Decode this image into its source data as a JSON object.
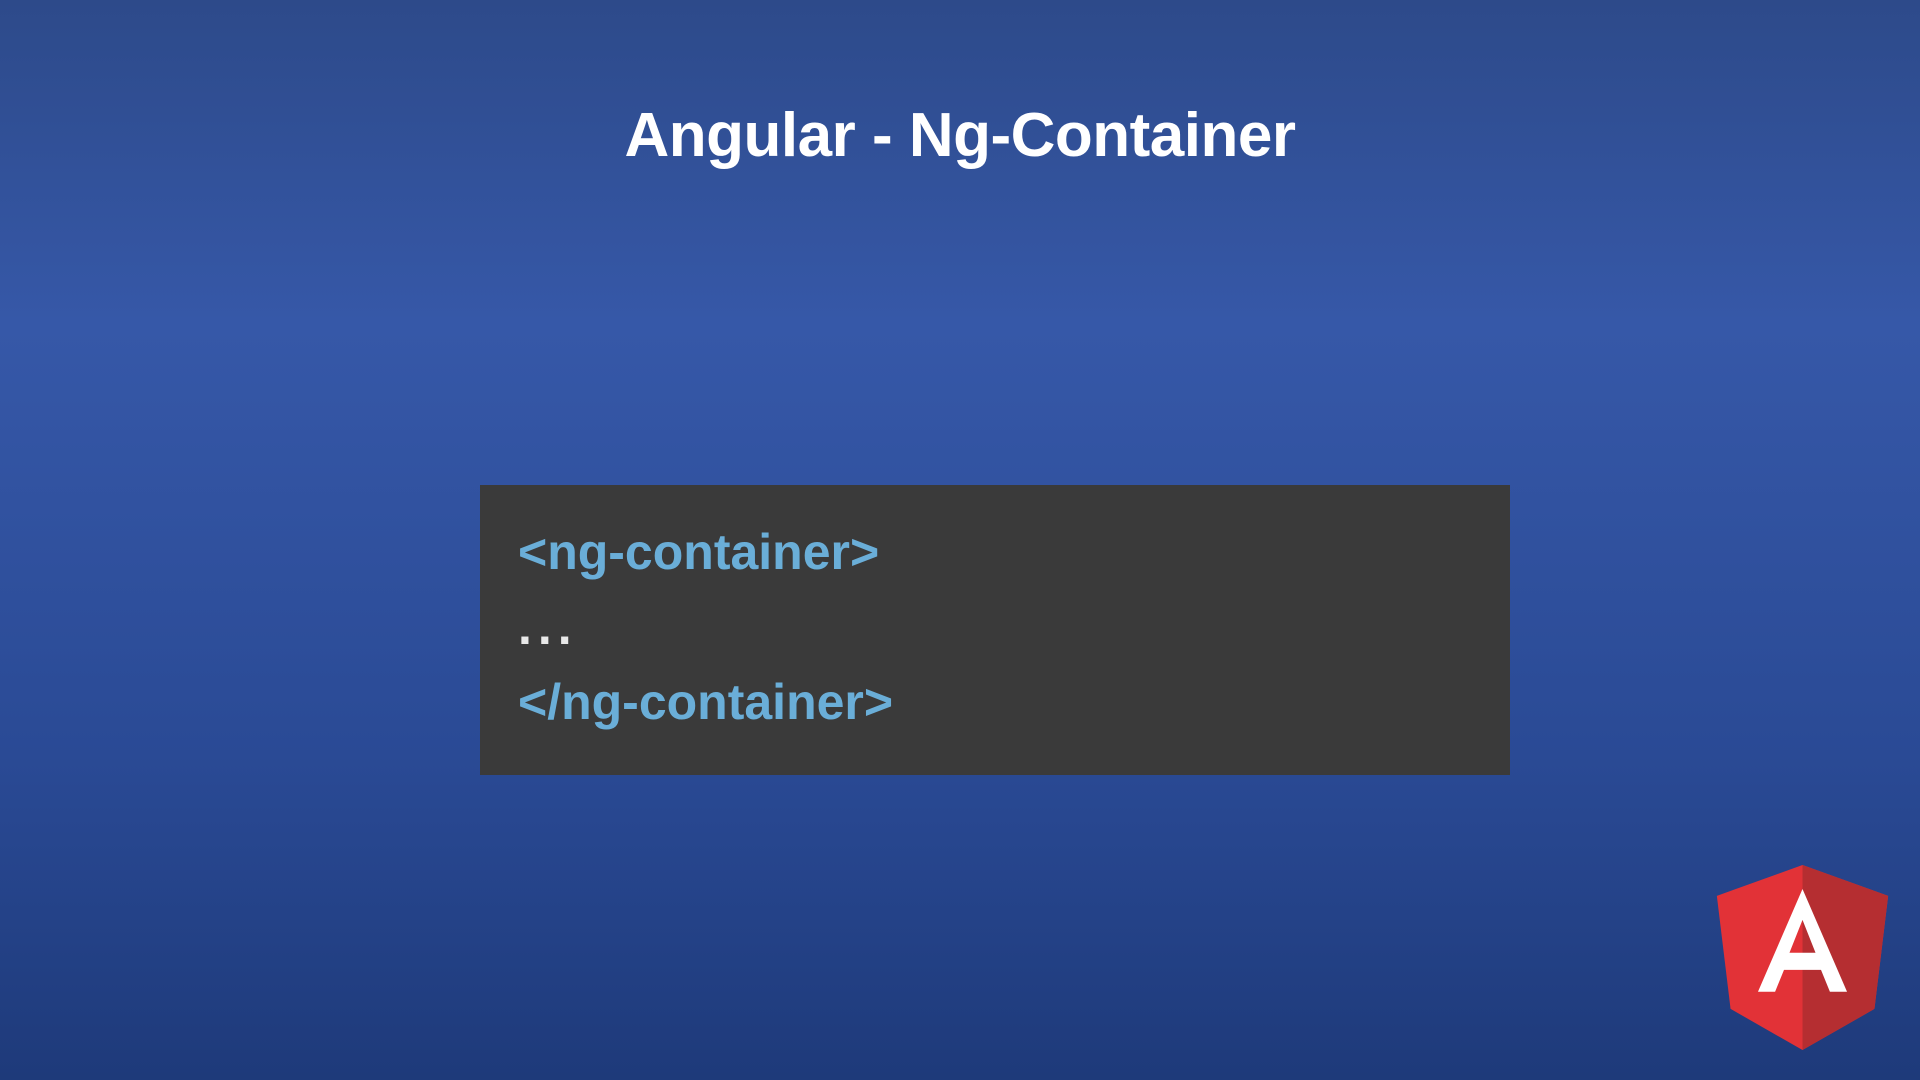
{
  "title": "Angular - Ng-Container",
  "code": {
    "line1": "<ng-container>",
    "line2": "...",
    "line3": "</ng-container>"
  },
  "logo": {
    "name": "angular-logo",
    "letter": "A",
    "colors": {
      "red_light": "#e23237",
      "red_dark": "#b52e31",
      "white": "#ffffff"
    }
  }
}
